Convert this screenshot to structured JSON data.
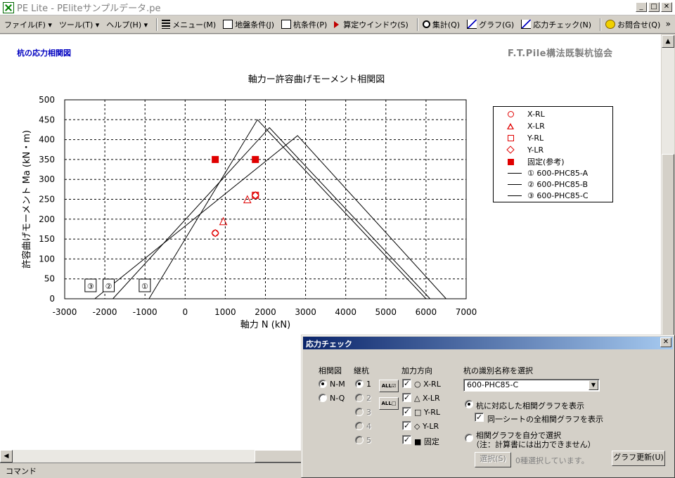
{
  "window": {
    "title": "PE Lite - PEliteサンプルデータ.pe",
    "app_icon": "excel-x-icon",
    "min_label": "_",
    "max_label": "□",
    "close_label": "✕"
  },
  "menu": {
    "file": "ファイル(F) ▾",
    "tools": "ツール(T) ▾",
    "help": "ヘルプ(H) ▾",
    "menu": "メニュー(M)",
    "ground": "地盤条件(J)",
    "pile": "杭条件(P)",
    "calc": "算定ウインドウ(S)",
    "summary": "集計(Q)",
    "graph": "グラフ(G)",
    "stress_check": "応力チェック(N)",
    "contact": "お問合せ(Q)",
    "overflow": "»"
  },
  "page": {
    "label": "杭の応力相関図",
    "org": "F.T.Pile構法既製杭協会"
  },
  "chart_data": {
    "type": "line",
    "title": "軸力ー許容曲げモーメント相関図",
    "xlabel": "軸力 N (kN)",
    "ylabel": "許容曲げモーメント Ma (kN・m)",
    "xlim": [
      -3000,
      7000
    ],
    "ylim": [
      0,
      500
    ],
    "xticks": [
      -3000,
      -2000,
      -1000,
      0,
      1000,
      2000,
      3000,
      4000,
      5000,
      6000,
      7000
    ],
    "yticks": [
      0,
      50,
      100,
      150,
      200,
      250,
      300,
      350,
      400,
      450,
      500
    ],
    "grid": true,
    "legend_position": "right",
    "series": [
      {
        "name": "① 600-PHC85-A",
        "marker": "①",
        "points": [
          [
            -900,
            0
          ],
          [
            1800,
            450
          ],
          [
            6000,
            0
          ]
        ]
      },
      {
        "name": "② 600-PHC85-B",
        "marker": "②",
        "points": [
          [
            -1800,
            0
          ],
          [
            2100,
            430
          ],
          [
            6100,
            0
          ]
        ]
      },
      {
        "name": "③ 600-PHC85-C",
        "marker": "③",
        "points": [
          [
            -2250,
            0
          ],
          [
            2800,
            410
          ],
          [
            6500,
            0
          ]
        ]
      }
    ],
    "scatter": [
      {
        "name": "X-RL",
        "symbol": "circle",
        "points": [
          [
            750,
            165
          ],
          [
            1750,
            260
          ]
        ]
      },
      {
        "name": "X-LR",
        "symbol": "triangle",
        "points": [
          [
            950,
            193
          ],
          [
            1550,
            248
          ]
        ]
      },
      {
        "name": "Y-RL",
        "symbol": "square",
        "points": [
          [
            1750,
            260
          ]
        ]
      },
      {
        "name": "Y-LR",
        "symbol": "diamond",
        "points": [
          [
            750,
            165
          ],
          [
            1750,
            260
          ]
        ]
      },
      {
        "name": "固定(参考)",
        "symbol": "filled-square",
        "points": [
          [
            750,
            350
          ],
          [
            1750,
            350
          ]
        ]
      }
    ],
    "legend": [
      "X-RL",
      "X-LR",
      "Y-RL",
      "Y-LR",
      "固定(参考)",
      "① 600-PHC85-A",
      "② 600-PHC85-B",
      "③ 600-PHC85-C"
    ],
    "colors": {
      "marker": "#e00000",
      "line": "#000000"
    }
  },
  "dialog": {
    "title": "応力チェック",
    "close_label": "✕",
    "relation_label": "相関図",
    "relation_options": [
      "N-M",
      "N-Q"
    ],
    "relation_selected": "N-M",
    "joint_label": "継杭",
    "joint_options": [
      "1",
      "2",
      "3",
      "4",
      "5"
    ],
    "joint_selected": "1",
    "all_on_label": "ALL☑",
    "all_off_label": "ALL□",
    "direction_label": "加力方向",
    "directions": [
      "○ X-RL",
      "△ X-LR",
      "□ Y-RL",
      "◇ Y-LR",
      "■ 固定"
    ],
    "select_label": "杭の識別名称を選択",
    "select_value": "600-PHC85-C",
    "select_arrow": "▼",
    "opt1_label": "杭に対応した相関グラフを表示",
    "opt1_sub_label": "同一シートの全相関グラフを表示",
    "opt2_label": "相関グラフを自分で選択",
    "opt2_note": "（注：計算書には出力できません）",
    "select_button": "選択(S)",
    "selected_count_text": "0種選択しています。",
    "update_button": "グラフ更新(U)"
  },
  "status": {
    "text": "コマンド"
  },
  "scroll": {
    "up": "▲",
    "down": "▼",
    "left": "◀",
    "right": "▶"
  }
}
